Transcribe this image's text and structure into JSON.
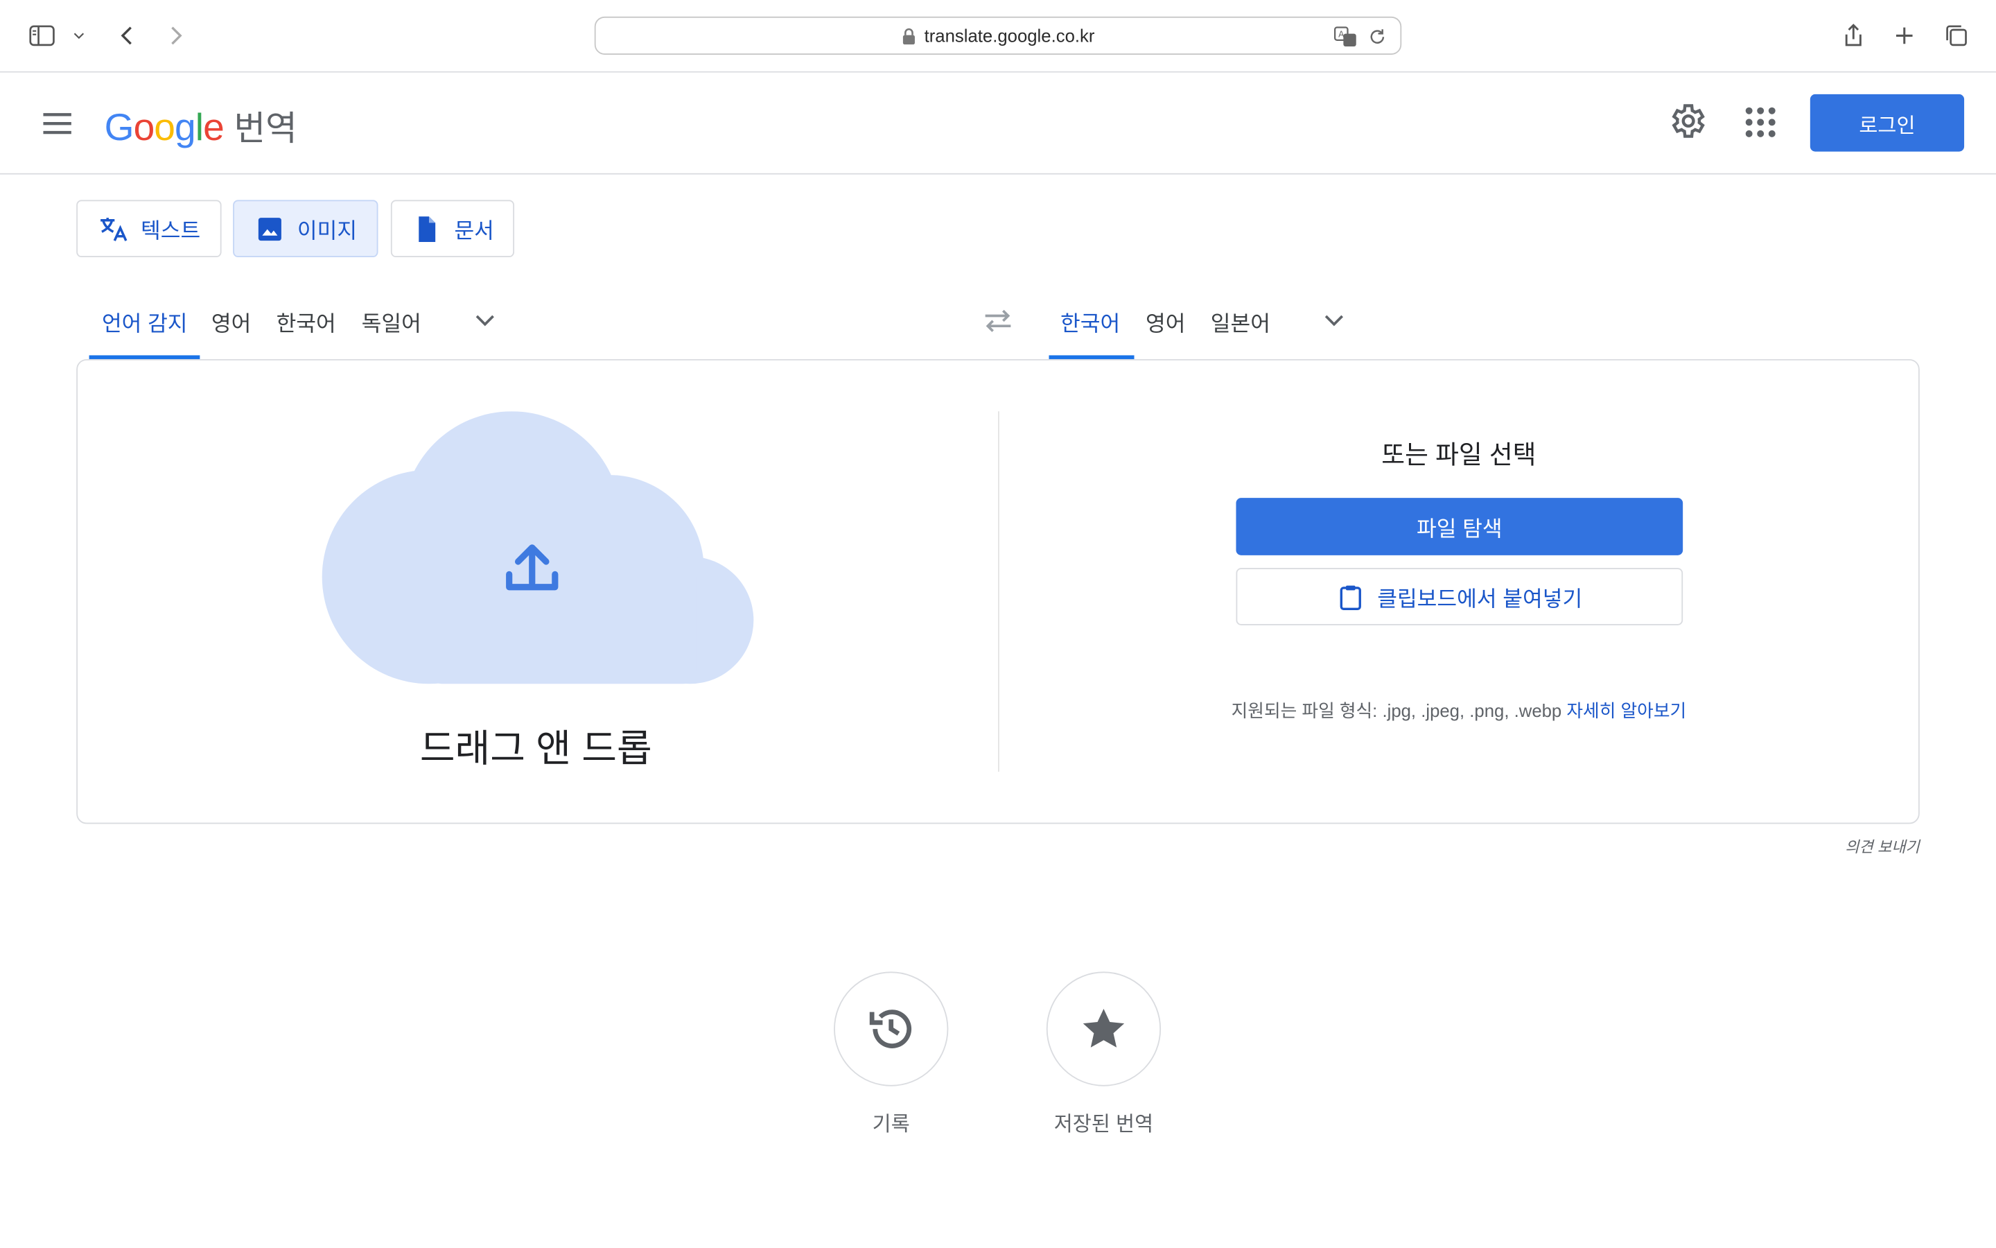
{
  "browser": {
    "url": "translate.google.co.kr"
  },
  "header": {
    "logo_letters": [
      {
        "ch": "G",
        "color": "#4285F4"
      },
      {
        "ch": "o",
        "color": "#EA4335"
      },
      {
        "ch": "o",
        "color": "#FBBC05"
      },
      {
        "ch": "g",
        "color": "#4285F4"
      },
      {
        "ch": "l",
        "color": "#34A853"
      },
      {
        "ch": "e",
        "color": "#EA4335"
      }
    ],
    "product": "번역",
    "login_label": "로그인"
  },
  "mode_tabs": {
    "text": "텍스트",
    "image": "이미지",
    "document": "문서",
    "active": "image"
  },
  "source_langs": {
    "items": [
      "언어 감지",
      "영어",
      "한국어",
      "독일어"
    ],
    "active_index": 0
  },
  "target_langs": {
    "items": [
      "한국어",
      "영어",
      "일본어"
    ],
    "active_index": 0
  },
  "upload": {
    "drag_drop": "드래그 앤 드롭",
    "or_choose": "또는 파일 선택",
    "browse_label": "파일 탐색",
    "paste_label": "클립보드에서 붙여넣기",
    "formats_text": "지원되는 파일 형식: .jpg, .jpeg, .png, .webp",
    "learn_more": "자세히 알아보기"
  },
  "feedback": "의견 보내기",
  "bottom": {
    "history_label": "기록",
    "saved_label": "저장된 번역"
  },
  "colors": {
    "accent": "#3273e0",
    "link": "#1a56c9",
    "cloud": "#d4e1f9",
    "cloud_icon": "#3f7ae0"
  }
}
